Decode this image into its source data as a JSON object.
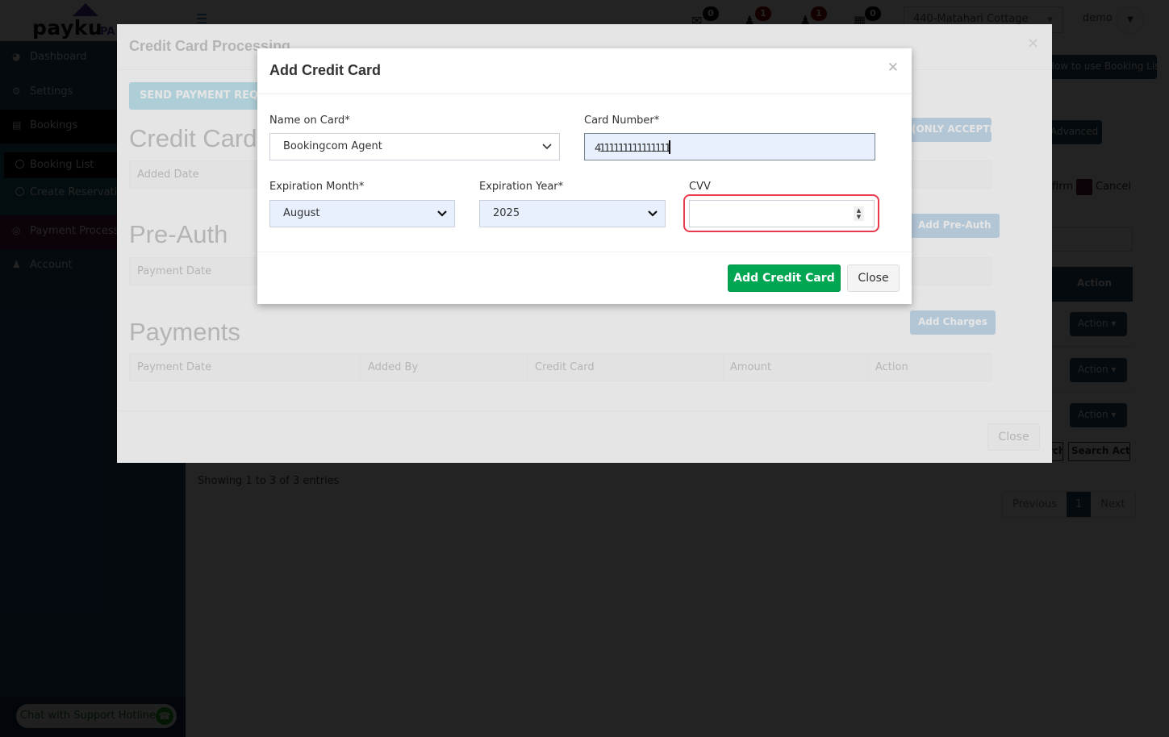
{
  "app": {
    "logo_text": "payku",
    "logo_sub": "PA",
    "notifications": [
      {
        "icon": "envelope-open-icon",
        "count": "0",
        "color": "#111111"
      },
      {
        "icon": "guest-checkin-icon",
        "count": "1",
        "color": "#8b0000"
      },
      {
        "icon": "guest-checkout-icon",
        "count": "1",
        "color": "#8b0000"
      },
      {
        "icon": "calendar-icon",
        "count": "0",
        "color": "#111111"
      }
    ],
    "property_select": "440-Matahari Cottage",
    "user_name": "demo"
  },
  "sidebar": {
    "items": [
      {
        "label": "Dashboard",
        "icon": "dashboard-icon"
      },
      {
        "label": "Settings",
        "icon": "gear-icon"
      },
      {
        "label": "Bookings",
        "icon": "bookings-icon"
      },
      {
        "label": "Payment Processing",
        "icon": "payment-icon"
      },
      {
        "label": "Account",
        "icon": "user-icon"
      }
    ],
    "sub_items": [
      {
        "label": "Booking List"
      },
      {
        "label": "Create Reservation"
      }
    ],
    "chat_label": "Chat with Support Hotline"
  },
  "background_page": {
    "guide_button": "How to use Booking List",
    "filter_button": "Advanced Filter",
    "legend": {
      "confirm": "Confirm",
      "cancel": "Cancel"
    },
    "table_header_action": "Action",
    "row_action_label": "Action",
    "row_count": 3,
    "search_buttons": [
      "Search Assign",
      "Search Action"
    ],
    "showing_text": "Showing 1 to 3 of 3 entries",
    "pagination": {
      "previous": "Previous",
      "current": "1",
      "next": "Next"
    }
  },
  "ccp_modal": {
    "title": "Credit Card Processing",
    "send_request_button": "SEND PAYMENT REQUEST",
    "accepted_button": "(ONLY ACCEPTED)",
    "sections": [
      {
        "title": "Credit Cards",
        "columns": [
          "Added Date"
        ]
      },
      {
        "title": "Pre-Auth",
        "columns": [
          "Payment Date"
        ],
        "button": "Add Pre-Auth"
      },
      {
        "title": "Payments",
        "columns": [
          "Payment Date",
          "Added By",
          "Credit Card",
          "Amount",
          "Action"
        ],
        "button": "Add Charges"
      }
    ],
    "close_button": "Close"
  },
  "add_card_modal": {
    "title": "Add Credit Card",
    "fields": {
      "name_on_card": {
        "label": "Name on Card*",
        "value": "Bookingcom Agent"
      },
      "card_number": {
        "label": "Card Number*",
        "value": "4111111111111111"
      },
      "exp_month": {
        "label": "Expiration Month*",
        "value": "August"
      },
      "exp_year": {
        "label": "Expiration Year*",
        "value": "2025"
      },
      "cvv": {
        "label": "CVV",
        "value": ""
      }
    },
    "submit_button": "Add Credit Card",
    "close_button": "Close",
    "highlight_color": "#e8394d",
    "submit_color": "#00a651"
  }
}
